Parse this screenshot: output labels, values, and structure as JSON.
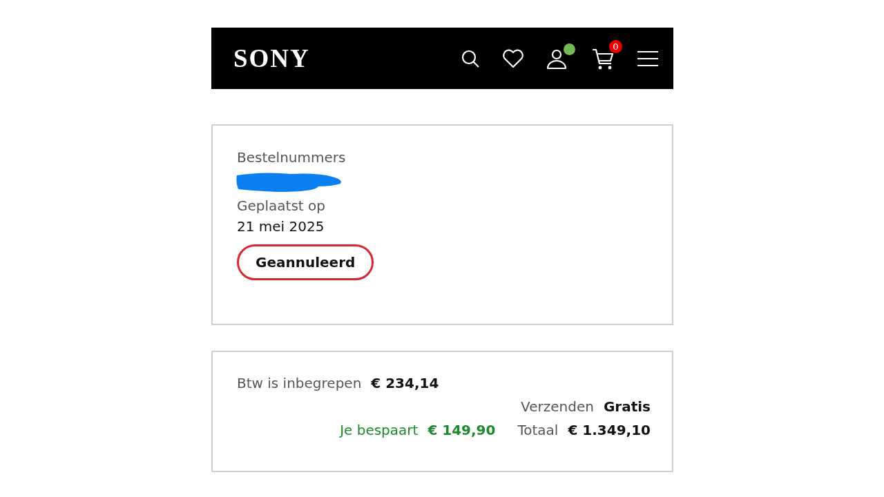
{
  "header": {
    "logo": "SONY",
    "account_signed_in": true,
    "cart_count": "0"
  },
  "order": {
    "number_label": "Bestelnummers",
    "number_redacted": true,
    "placed_label": "Geplaatst op",
    "placed_date": "21 mei 2025",
    "status": {
      "label": "Geannuleerd",
      "kind": "cancelled"
    }
  },
  "summary": {
    "vat_label": "Btw is inbegrepen",
    "vat_value": "€ 234,14",
    "shipping_label": "Verzenden",
    "shipping_value": "Gratis",
    "savings_label": "Je bespaart",
    "savings_value": "€ 149,90",
    "total_label": "Totaal",
    "total_value": "€ 1.349,10"
  }
}
